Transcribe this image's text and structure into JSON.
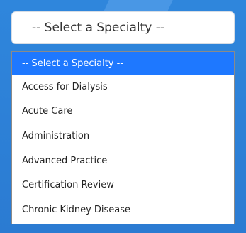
{
  "select": {
    "value": "-- Select a Specialty --"
  },
  "dropdown": {
    "options": [
      "-- Select a Specialty --",
      "Access for Dialysis",
      "Acute Care",
      "Administration",
      "Advanced Practice",
      "Certification Review",
      "Chronic Kidney Disease"
    ],
    "selected_index": 0
  },
  "colors": {
    "background": "#2d7fd6",
    "highlight": "#1e78ff"
  }
}
